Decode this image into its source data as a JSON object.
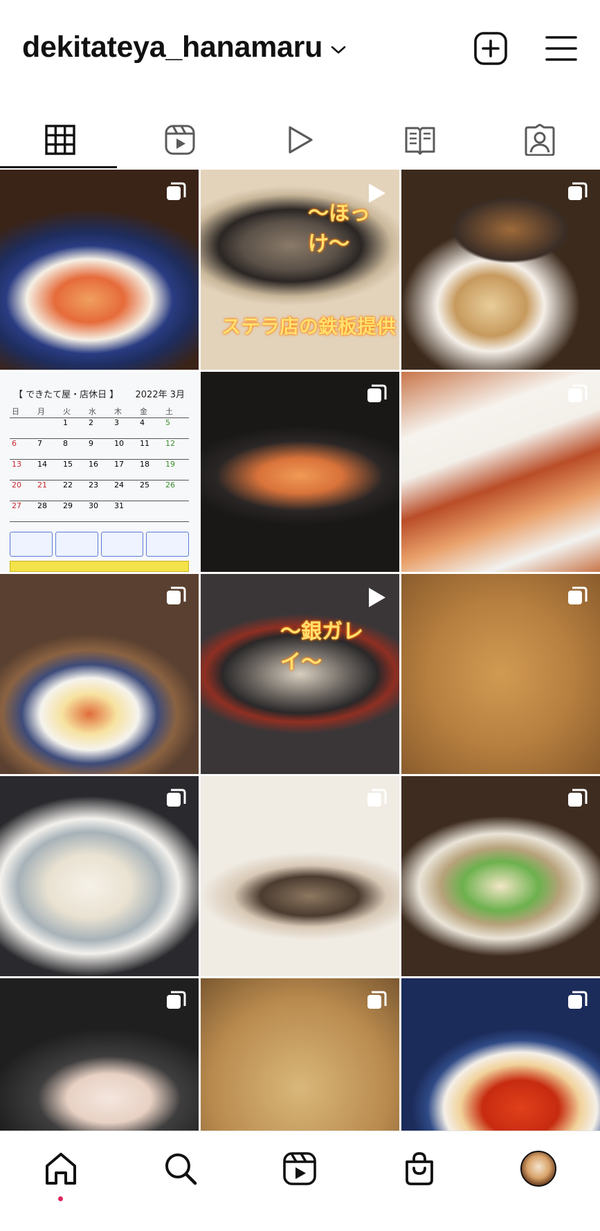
{
  "header": {
    "username": "dekitateya_hanamaru",
    "icons": {
      "switch": "chevron-down-icon",
      "new_post": "plus-square-icon",
      "menu": "hamburger-menu-icon"
    }
  },
  "tabs": [
    {
      "name": "grid",
      "icon": "grid-icon",
      "active": true
    },
    {
      "name": "reels",
      "icon": "reels-icon",
      "active": false
    },
    {
      "name": "videos",
      "icon": "play-icon",
      "active": false
    },
    {
      "name": "guides",
      "icon": "guide-book-icon",
      "active": false
    },
    {
      "name": "tagged",
      "icon": "tagged-person-icon",
      "active": false
    }
  ],
  "posts": [
    {
      "type": "carousel",
      "badge_icon": "carousel-icon"
    },
    {
      "type": "reel",
      "badge_icon": "play-icon",
      "overlay_top": "〜ほっけ〜",
      "overlay_bottom": "ステラ店の鉄板提供"
    },
    {
      "type": "carousel",
      "badge_icon": "carousel-icon"
    },
    {
      "type": "image",
      "calendar": {
        "title": "【 できたて屋・店休日 】",
        "month": "2022年 3月",
        "weekdays": [
          "日",
          "月",
          "火",
          "水",
          "木",
          "金",
          "土"
        ],
        "weeks": [
          [
            "",
            "",
            "1",
            "2",
            "3",
            "4",
            "5"
          ],
          [
            "6",
            "7",
            "8",
            "9",
            "10",
            "11",
            "12"
          ],
          [
            "13",
            "14",
            "15",
            "16",
            "17",
            "18",
            "19"
          ],
          [
            "20",
            "21",
            "22",
            "23",
            "24",
            "25",
            "26"
          ],
          [
            "27",
            "28",
            "29",
            "30",
            "31",
            "",
            ""
          ]
        ]
      }
    },
    {
      "type": "carousel",
      "badge_icon": "carousel-icon"
    },
    {
      "type": "carousel",
      "badge_icon": "carousel-icon"
    },
    {
      "type": "carousel",
      "badge_icon": "carousel-icon"
    },
    {
      "type": "reel",
      "badge_icon": "play-icon",
      "overlay_top": "〜銀ガレイ〜"
    },
    {
      "type": "carousel",
      "badge_icon": "carousel-icon"
    },
    {
      "type": "carousel",
      "badge_icon": "carousel-icon"
    },
    {
      "type": "carousel",
      "badge_icon": "carousel-icon"
    },
    {
      "type": "carousel",
      "badge_icon": "carousel-icon"
    },
    {
      "type": "carousel",
      "badge_icon": "carousel-icon"
    },
    {
      "type": "carousel",
      "badge_icon": "carousel-icon"
    },
    {
      "type": "carousel",
      "badge_icon": "carousel-icon"
    }
  ],
  "bottom_nav": [
    {
      "name": "home",
      "icon": "home-icon",
      "active": true,
      "accent": "#e0245e"
    },
    {
      "name": "search",
      "icon": "search-icon"
    },
    {
      "name": "reels",
      "icon": "reels-icon"
    },
    {
      "name": "shop",
      "icon": "shopping-bag-icon"
    },
    {
      "name": "profile",
      "icon": "avatar"
    }
  ]
}
